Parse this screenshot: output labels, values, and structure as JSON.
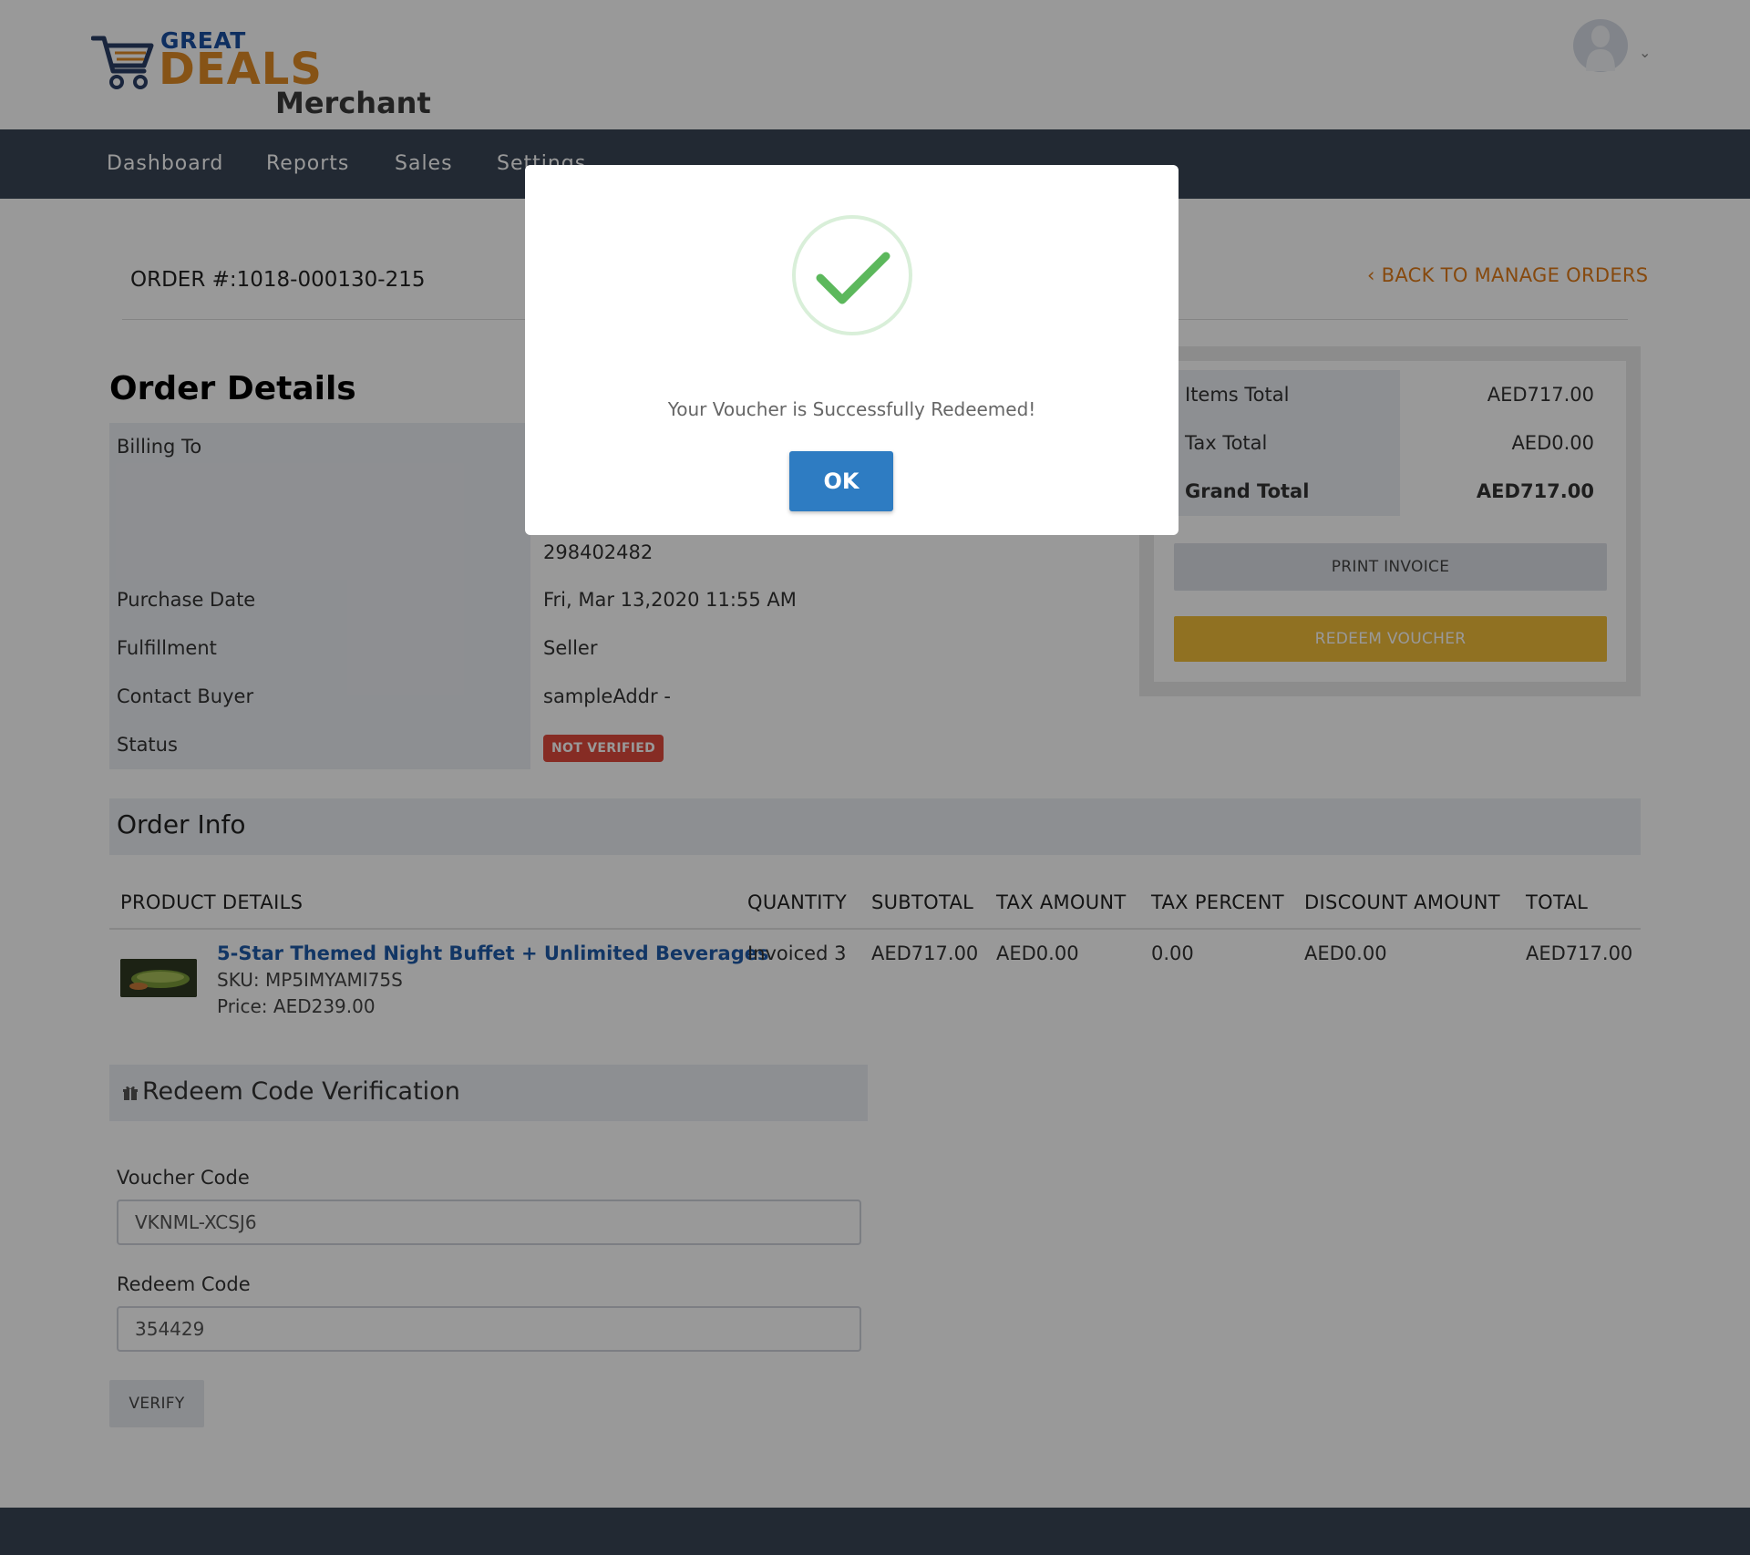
{
  "brand": {
    "top": "GREAT",
    "main": "DEALS",
    "sub": "Merchant"
  },
  "nav": [
    {
      "label": "Dashboard"
    },
    {
      "label": "Reports"
    },
    {
      "label": "Sales"
    },
    {
      "label": "Settings"
    }
  ],
  "order": {
    "number": "ORDER #:1018-000130-215",
    "back_link": "‹ BACK TO MANAGE ORDERS"
  },
  "details": {
    "title": "Order Details",
    "billing_label": "Billing To",
    "billing_value": "298402482",
    "purchase_label": "Purchase Date",
    "purchase_value": "Fri, Mar 13,2020 11:55 AM",
    "fulfillment_label": "Fulfillment",
    "fulfillment_value": "Seller",
    "contact_label": "Contact Buyer",
    "contact_value": "sampleAddr -",
    "status_label": "Status",
    "status_value": "NOT VERIFIED"
  },
  "totals": {
    "items_label": "Items Total",
    "items_value": "AED717.00",
    "tax_label": "Tax Total",
    "tax_value": "AED0.00",
    "grand_label": "Grand Total",
    "grand_value": "AED717.00",
    "print_button": "PRINT INVOICE",
    "redeem_button": "REDEEM VOUCHER"
  },
  "order_info": {
    "title": "Order Info",
    "columns": [
      "PRODUCT DETAILS",
      "QUANTITY",
      "SUBTOTAL",
      "TAX AMOUNT",
      "TAX PERCENT",
      "DISCOUNT AMOUNT",
      "TOTAL"
    ],
    "row": {
      "name": "5-Star Themed Night Buffet + Unlimited Beverages",
      "sku": "SKU: MP5IMYAMI75S",
      "price": "Price: AED239.00",
      "quantity": "Invoiced 3",
      "subtotal": "AED717.00",
      "tax_amount": "AED0.00",
      "tax_percent": "0.00",
      "discount": "AED0.00",
      "total": "AED717.00"
    }
  },
  "redeem": {
    "title": "Redeem Code Verification",
    "voucher_label": "Voucher Code",
    "voucher_value": "VKNML-XCSJ6",
    "code_label": "Redeem Code",
    "code_value": "354429",
    "verify_button": "VERIFY"
  },
  "modal": {
    "message": "Your Voucher is Successfully Redeemed!",
    "ok_button": "OK"
  },
  "colors": {
    "nav_bg": "#3a4556",
    "accent_orange": "#e07b18",
    "redeem_yellow": "#f0bc3a",
    "status_red": "#e04a3c",
    "ok_blue": "#2e7cc2",
    "success_green": "#5cb85c"
  }
}
